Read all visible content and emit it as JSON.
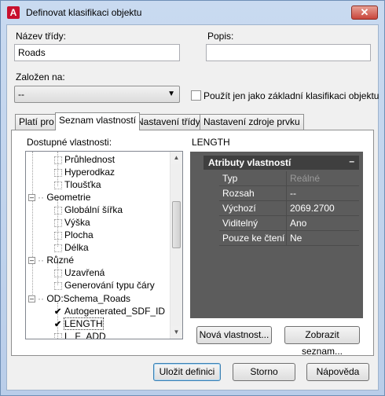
{
  "window": {
    "title": "Definovat klasifikaci objektu",
    "close_label": "✕",
    "app_icon": "A"
  },
  "class_name": {
    "label": "Název třídy:",
    "value": "Roads"
  },
  "description": {
    "label": "Popis:",
    "value": ""
  },
  "based_on": {
    "label": "Založen na:",
    "selected": "--"
  },
  "use_as_base": {
    "label": "Použít jen jako základní klasifikaci objektu",
    "checked": false
  },
  "tabs": [
    {
      "label": "Platí pro",
      "active": false
    },
    {
      "label": "Seznam vlastností",
      "active": true
    },
    {
      "label": "Nastavení třídy",
      "active": false
    },
    {
      "label": "Nastavení zdroje prvku",
      "active": false
    }
  ],
  "available_props_label": "Dostupné vlastnosti:",
  "tree": {
    "items": [
      {
        "label": "Průhlednost",
        "kind": "leaf",
        "checked": false
      },
      {
        "label": "Hyperodkaz",
        "kind": "leaf",
        "checked": false
      },
      {
        "label": "Tloušťka",
        "kind": "leaf",
        "checked": false
      },
      {
        "label": "Geometrie",
        "kind": "group"
      },
      {
        "label": "Globální šířka",
        "kind": "leaf",
        "checked": false
      },
      {
        "label": "Výška",
        "kind": "leaf",
        "checked": false
      },
      {
        "label": "Plocha",
        "kind": "leaf",
        "checked": false
      },
      {
        "label": "Délka",
        "kind": "leaf",
        "checked": false
      },
      {
        "label": "Různé",
        "kind": "group"
      },
      {
        "label": "Uzavřená",
        "kind": "leaf",
        "checked": false
      },
      {
        "label": "Generování typu čáry",
        "kind": "leaf",
        "checked": false
      },
      {
        "label": "OD:Schema_Roads",
        "kind": "group"
      },
      {
        "label": "Autogenerated_SDF_ID",
        "kind": "leaf",
        "checked": true
      },
      {
        "label": "LENGTH",
        "kind": "leaf",
        "checked": true,
        "selected": true
      },
      {
        "label": "L_F_ADD",
        "kind": "leaf",
        "checked": false
      }
    ]
  },
  "selected_property": "LENGTH",
  "attributes": {
    "header": "Atributy vlastností",
    "collapse": "–",
    "rows": [
      {
        "key": "Typ",
        "value": "Reálné",
        "dim": true
      },
      {
        "key": "Rozsah",
        "value": "--"
      },
      {
        "key": "Výchozí",
        "value": "2069.2700"
      },
      {
        "key": "Viditelný",
        "value": "Ano"
      },
      {
        "key": "Pouze ke čtení",
        "value": "Ne"
      }
    ]
  },
  "buttons": {
    "new_property": "Nová vlastnost...",
    "show_list": "Zobrazit seznam...",
    "save": "Uložit definici",
    "cancel": "Storno",
    "help": "Nápověda"
  }
}
